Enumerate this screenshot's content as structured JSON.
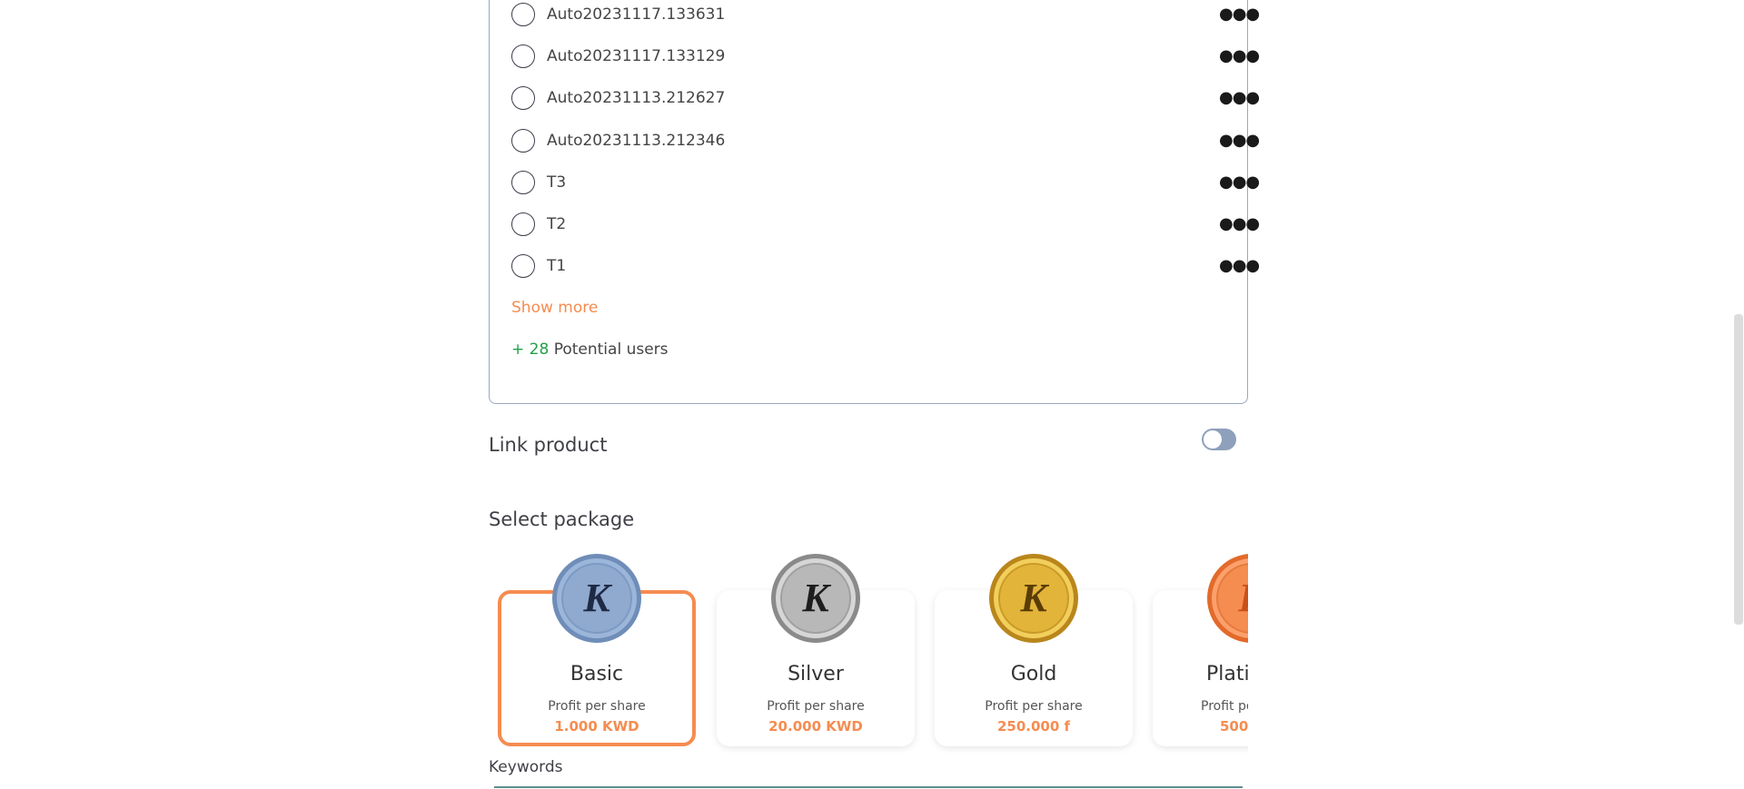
{
  "users": [
    {
      "name": "Auto20231117.133631"
    },
    {
      "name": "Auto20231117.133129"
    },
    {
      "name": "Auto20231113.212627"
    },
    {
      "name": "Auto20231113.212346"
    },
    {
      "name": "T3"
    },
    {
      "name": "T2"
    },
    {
      "name": "T1"
    }
  ],
  "icons": {
    "row_more": "more-horizontal-icon"
  },
  "show_more_label": "Show more",
  "potential_users": {
    "count": "+ 28",
    "label": "Potential users"
  },
  "link_product": {
    "label": "Link product",
    "enabled": false
  },
  "select_package": {
    "label": "Select package"
  },
  "packages": [
    {
      "name": "Basic",
      "profit_label": "Profit per share",
      "profit_value": "1.000 KWD",
      "selected": true,
      "coin_color": "#8fa9cf"
    },
    {
      "name": "Silver",
      "profit_label": "Profit per share",
      "profit_value": "20.000 KWD",
      "selected": false,
      "coin_color": "#b8b8b8"
    },
    {
      "name": "Gold",
      "profit_label": "Profit per share",
      "profit_value": "250.000 f",
      "selected": false,
      "coin_color": "#e3b43a"
    },
    {
      "name": "Plati",
      "profit_label": "Profit pe",
      "profit_value": "500.",
      "selected": false,
      "coin_color": "#f58c50"
    }
  ],
  "keywords": {
    "label": "Keywords"
  },
  "colors": {
    "accent": "#f58c50",
    "positive": "#22a04a",
    "border": "#9aa8bd"
  }
}
